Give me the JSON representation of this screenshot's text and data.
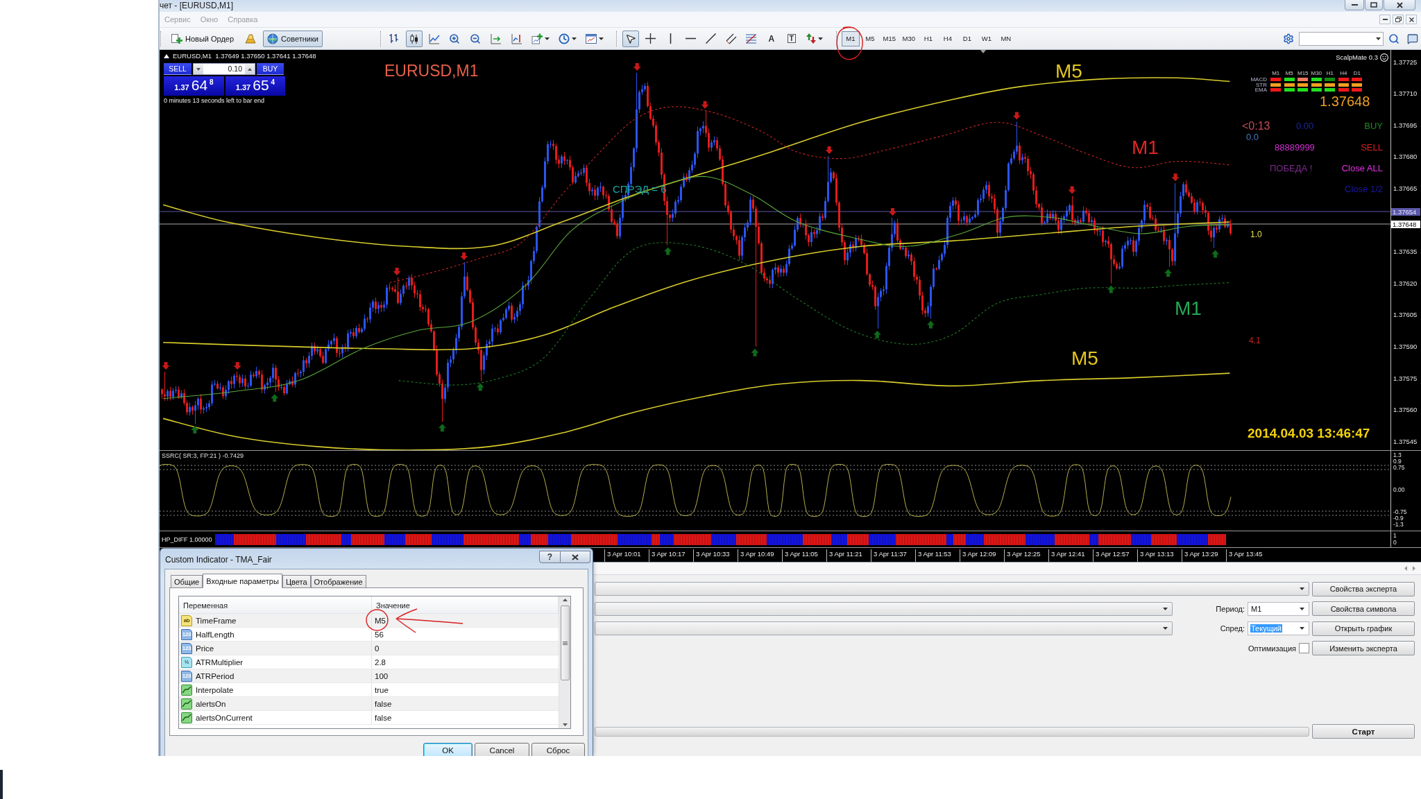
{
  "window": {
    "title": "чет - [EURUSD,M1]"
  },
  "menu": [
    {
      "label": "Сервис",
      "disabled": true
    },
    {
      "label": "Окно",
      "disabled": true
    },
    {
      "label": "Справка",
      "disabled": true
    }
  ],
  "toolbar": {
    "actions": [
      {
        "kind": "new-order",
        "label": "Новый Ордер",
        "on": false
      },
      {
        "kind": "ingot",
        "on": false
      },
      {
        "kind": "experts",
        "label": "Советники",
        "on": true
      }
    ],
    "chart_types": [
      {
        "kind": "bars",
        "selected": false
      },
      {
        "kind": "candles",
        "selected": true
      },
      {
        "kind": "line",
        "selected": false
      }
    ],
    "view_tools": [
      {
        "kind": "zoom-in"
      },
      {
        "kind": "zoom-out"
      },
      {
        "kind": "autoscroll"
      },
      {
        "kind": "shift"
      },
      {
        "kind": "indicators"
      },
      {
        "kind": "periods"
      },
      {
        "kind": "templates"
      }
    ],
    "draw_tools": [
      {
        "kind": "cursor",
        "selected": true
      },
      {
        "kind": "crosshair",
        "selected": false
      },
      {
        "kind": "vline",
        "selected": false
      },
      {
        "kind": "hline",
        "selected": false
      },
      {
        "kind": "trend",
        "selected": false
      },
      {
        "kind": "channel",
        "selected": false
      },
      {
        "kind": "fibo",
        "selected": false
      },
      {
        "kind": "text",
        "glyph": "A",
        "selected": false
      },
      {
        "kind": "label",
        "glyph": "T",
        "selected": false
      },
      {
        "kind": "arrows",
        "selected": false
      }
    ],
    "timeframes": [
      {
        "label": "M1",
        "selected": true
      },
      {
        "label": "M5",
        "selected": false
      },
      {
        "label": "M15",
        "selected": false
      },
      {
        "label": "M30",
        "selected": false
      },
      {
        "label": "H1",
        "selected": false
      },
      {
        "label": "H4",
        "selected": false
      },
      {
        "label": "D1",
        "selected": false
      },
      {
        "label": "W1",
        "selected": false
      },
      {
        "label": "MN",
        "selected": false
      }
    ]
  },
  "chart": {
    "header": "EURUSD,M1  1.37649 1.37650 1.37641 1.37648",
    "trade": {
      "sell": "SELL",
      "buy": "BUY",
      "lot": "0.10",
      "sell_price": [
        "1.37",
        "64",
        "8"
      ],
      "buy_price": [
        "1.37",
        "65",
        "4"
      ]
    },
    "timer": "0 minutes 13 seconds left to bar end",
    "labels": [
      {
        "text": "EURUSD,M1",
        "color": "#e8604a"
      },
      {
        "text": "M5",
        "color": "#e6c81c"
      },
      {
        "text": "M1",
        "color": "#e02626"
      },
      {
        "text": "M1",
        "color": "#22aa55"
      },
      {
        "text": "M5",
        "color": "#e6c81c"
      },
      {
        "text": "СПРЭД = 6",
        "color": "#1fa3a3"
      }
    ],
    "panel": {
      "title": "ScalpMate 0.3",
      "columns": [
        "M1",
        "M5",
        "M15",
        "M30",
        "H1",
        "H4",
        "D1"
      ],
      "rows": [
        {
          "label": "MACD",
          "cells": [
            {
              "color": "#f01818"
            },
            {
              "color": "#20e020"
            },
            {
              "color": "#f07860"
            },
            {
              "color": "#20e020"
            },
            {
              "color": "#108a10"
            },
            {
              "color": "#f01818"
            },
            {
              "color": "#f01818"
            }
          ]
        },
        {
          "label": "STR",
          "cells": [
            {
              "color": "#f0a020"
            },
            {
              "color": "#f0a020"
            },
            {
              "color": "#f0a020"
            },
            {
              "color": "#f0a020"
            },
            {
              "color": "#f0a020"
            },
            {
              "color": "#f0a020"
            },
            {
              "color": "#f0a020"
            }
          ]
        },
        {
          "label": "EMA",
          "cells": [
            {
              "color": "#f01818"
            },
            {
              "color": "#20e020"
            },
            {
              "color": "#20e020"
            },
            {
              "color": "#20e020"
            },
            {
              "color": "#20e020"
            },
            {
              "color": "#f01818"
            },
            {
              "color": "#f01818"
            }
          ]
        }
      ],
      "price": "1.37648",
      "texts": [
        {
          "text": "<0:13",
          "color": "#c84858"
        },
        {
          "text": "0.0",
          "color": "#4878c0"
        },
        {
          "text": "0.00",
          "color": "#1828a0"
        },
        {
          "text": "BUY",
          "color": "#1e8a1e"
        },
        {
          "text": "88889999",
          "color": "#d030d0"
        },
        {
          "text": "SELL",
          "color": "#d82020"
        },
        {
          "text": "ПОБЕДА !",
          "color": "#7a2a8a"
        },
        {
          "text": "Close ALL",
          "color": "#e030e0"
        },
        {
          "text": "Close 1/2",
          "color": "#1818a8"
        },
        {
          "text": "1.0",
          "color": "#e8e040"
        },
        {
          "text": "4.1",
          "color": "#c82020"
        }
      ],
      "clock": "2014.04.03 13:46:47"
    },
    "price_axis": {
      "labels": [
        "1.37725",
        "1.37710",
        "1.37695",
        "1.37680",
        "1.37665",
        "1.37635",
        "1.37620",
        "1.37605",
        "1.37590",
        "1.37575",
        "1.37560",
        "1.37545"
      ],
      "ask": "1.37654",
      "bid": "1.37648"
    },
    "oscillator": {
      "title": "SSRC( SR:3, FP:21 ) -0.7429",
      "axis": [
        "1.3",
        "0.9",
        "0.75",
        "0.00",
        "-0.75",
        "-0.9",
        "-1.3"
      ]
    },
    "hp_diff": {
      "title": "HP_DIFF 1.00000",
      "axis": [
        "1",
        "0"
      ]
    },
    "time_axis": [
      "3 Apr 10:01",
      "3 Apr 10:17",
      "3 Apr 10:33",
      "3 Apr 10:49",
      "3 Apr 11:05",
      "3 Apr 11:21",
      "3 Apr 11:37",
      "3 Apr 11:53",
      "3 Apr 12:09",
      "3 Apr 12:25",
      "3 Apr 12:41",
      "3 Apr 12:57",
      "3 Apr 13:13",
      "3 Apr 13:29",
      "3 Apr 13:45"
    ]
  },
  "tester": {
    "rows": [
      {
        "kind": "wide",
        "button": "Свойства эксперта"
      },
      {
        "kind": "select",
        "label": "Период:",
        "value": "M1",
        "focused": false,
        "button": "Свойства символа"
      },
      {
        "kind": "select",
        "label": "Спред:",
        "value": "Текущий",
        "focused": true,
        "button": "Открыть график"
      },
      {
        "kind": "check",
        "label": "Оптимизация",
        "checked": false,
        "button": "Изменить эксперта"
      }
    ],
    "progress": {
      "level": 0
    },
    "start": "Старт"
  },
  "dialog": {
    "title": "Custom Indicator - TMA_Fair",
    "help": "?",
    "tabs": [
      {
        "label": "Общие",
        "selected": false
      },
      {
        "label": "Входные параметры",
        "selected": true
      },
      {
        "label": "Цвета",
        "selected": false
      },
      {
        "label": "Отображение",
        "selected": false
      }
    ],
    "columns": [
      "Переменная",
      "Значение"
    ],
    "params": [
      {
        "kind": "string",
        "tag": "ab",
        "name": "TimeFrame",
        "value": "M5"
      },
      {
        "kind": "int",
        "tag": "123",
        "name": "HalfLength",
        "value": "56"
      },
      {
        "kind": "int",
        "tag": "123",
        "name": "Price",
        "value": "0"
      },
      {
        "kind": "double",
        "tag": "½",
        "name": "ATRMultiplier",
        "value": "2.8"
      },
      {
        "kind": "int",
        "tag": "123",
        "name": "ATRPeriod",
        "value": "100"
      },
      {
        "kind": "bool",
        "name": "Interpolate",
        "value": "true"
      },
      {
        "kind": "bool",
        "name": "alertsOn",
        "value": "false"
      },
      {
        "kind": "bool",
        "name": "alertsOnCurrent",
        "value": "false"
      }
    ],
    "buttons": [
      {
        "label": "OK",
        "default": true
      },
      {
        "label": "Cancel",
        "default": false
      },
      {
        "label": "Сброс",
        "default": false
      }
    ]
  }
}
